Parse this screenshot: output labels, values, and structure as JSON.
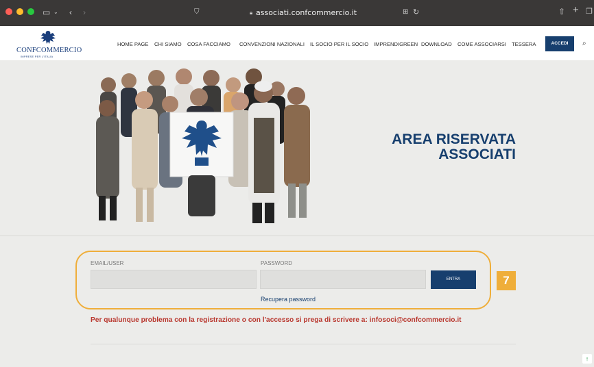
{
  "browser": {
    "url": "associati.confcommercio.it",
    "icons": [
      "sidebar-icon",
      "chevron-down-icon",
      "back-icon",
      "forward-icon",
      "shield-icon",
      "lock-icon",
      "translate-icon",
      "reload-icon",
      "share-icon",
      "plus-icon",
      "tabs-icon"
    ],
    "traffic_lights": [
      "#fe5f57",
      "#febc2e",
      "#28c840"
    ]
  },
  "site": {
    "logo_text": "CONFCOMMERCIO",
    "logo_sub": "IMPRESE PER L'ITALIA",
    "nav": [
      "HOME PAGE",
      "CHI SIAMO",
      "COSA FACCIAMO",
      "CONVENZIONI NAZIONALI",
      "IL SOCIO PER IL SOCIO",
      "IMPRENDIGREEN",
      "DOWNLOAD",
      "COME ASSOCIARSI",
      "TESSERA"
    ],
    "accedi_label": "ACCEDI",
    "search_icon": "search-icon"
  },
  "hero": {
    "title_line1": "AREA RISERVATA",
    "title_line2": "ASSOCIATI"
  },
  "login": {
    "email_label": "EMAIL/USER",
    "password_label": "PASSWORD",
    "email_value": "",
    "password_value": "",
    "submit_label": "ENTRA",
    "recover_link": "Recupera password"
  },
  "annotation": {
    "badge": "7",
    "color": "#efae3a"
  },
  "notice": "Per qualunque problema con la registrazione o con l'accesso si prega di scrivere a: infosoci@confcommercio.it",
  "colors": {
    "brand": "#173f6e",
    "alert": "#b9372e",
    "background": "#ececea"
  }
}
